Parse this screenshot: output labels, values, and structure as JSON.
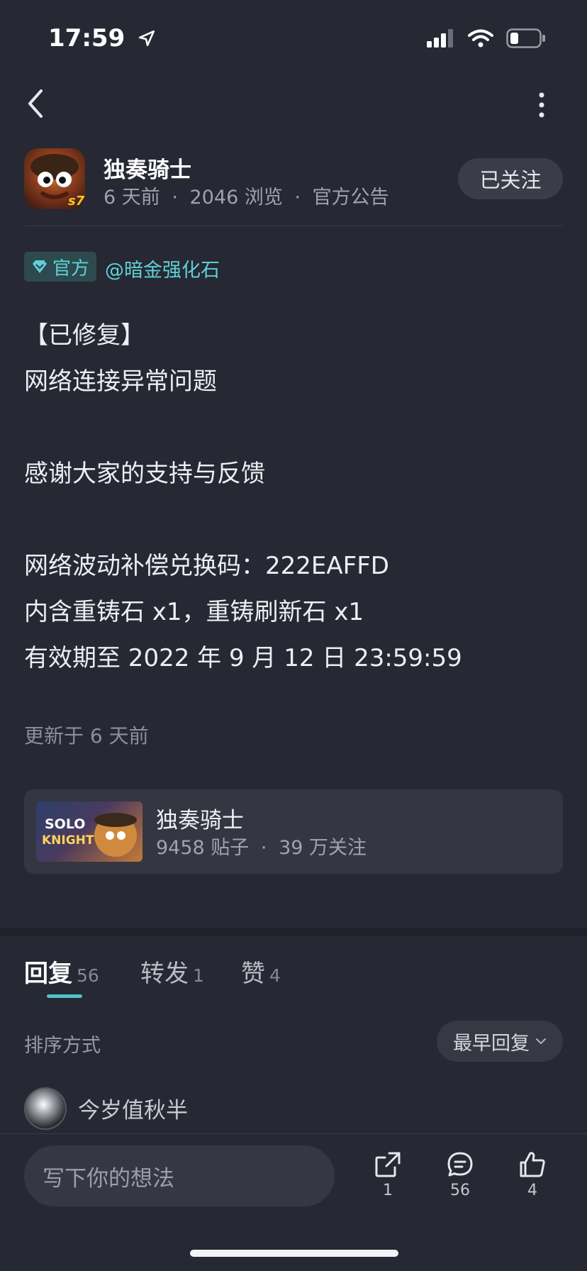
{
  "status_bar": {
    "time": "17:59"
  },
  "author": {
    "name": "独奏骑士",
    "time_ago": "6 天前",
    "views": "2046 浏览",
    "category": "官方公告",
    "follow_label": "已关注"
  },
  "post": {
    "official_label": "官方",
    "mention": "@暗金强化石",
    "lines": [
      "【已修复】",
      "网络连接异常问题",
      "",
      "感谢大家的支持与反馈",
      "",
      "网络波动补偿兑换码：222EAFFD",
      "内含重铸石 x1，重铸刷新石 x1",
      "有效期至 2022 年 9 月 12 日 23:59:59"
    ],
    "updated": "更新于 6 天前"
  },
  "game_card": {
    "thumb_text_1": "SOLO",
    "thumb_text_2": "KNIGHT",
    "title": "独奏骑士",
    "posts": "9458 贴子",
    "followers": "39 万关注"
  },
  "tabs": [
    {
      "label": "回复",
      "count": "56"
    },
    {
      "label": "转发",
      "count": "1"
    },
    {
      "label": "赞",
      "count": "4"
    }
  ],
  "sort": {
    "label": "排序方式",
    "value": "最早回复"
  },
  "reply": {
    "username": "今岁值秋半"
  },
  "bottom": {
    "input_placeholder": "写下你的想法",
    "share_count": "1",
    "comment_count": "56",
    "like_count": "4"
  },
  "colors": {
    "background": "#262833",
    "accent": "#5fd0d6",
    "tab_underline": "#4fc3c9"
  }
}
